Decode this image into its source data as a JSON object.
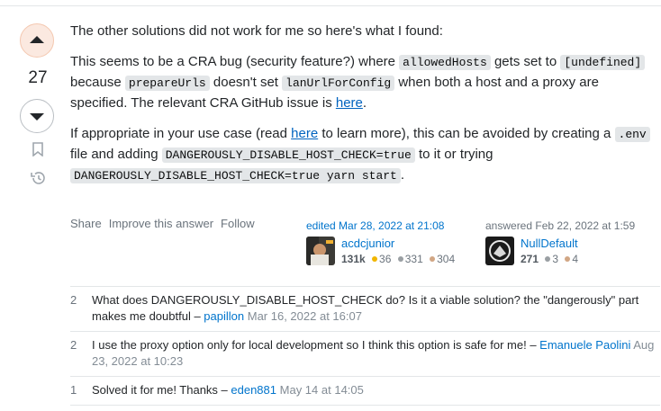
{
  "vote": {
    "count": "27"
  },
  "post": {
    "p1": "The other solutions did not work for me so here's what I found:",
    "p2_a": "This seems to be a CRA bug (security feature?) where ",
    "p2_code1": "allowedHosts",
    "p2_b": " gets set to ",
    "p2_code2": "[undefined]",
    "p2_c": " because ",
    "p2_code3": "prepareUrls",
    "p2_d": " doesn't set ",
    "p2_code4": "lanUrlForConfig",
    "p2_e": " when both a host and a proxy are specified. The relevant CRA GitHub issue is ",
    "p2_link": "here",
    "p2_f": ".",
    "p3_a": "If appropriate in your use case (read ",
    "p3_link": "here",
    "p3_b": " to learn more), this can be avoided by creating a ",
    "p3_code1": ".env",
    "p3_c": " file and adding ",
    "p3_code2": "DANGEROUSLY_DISABLE_HOST_CHECK=true",
    "p3_d": " to it or trying ",
    "p3_code3": "DANGEROUSLY_DISABLE_HOST_CHECK=true yarn start",
    "p3_e": "."
  },
  "menu": {
    "share": "Share",
    "improve": "Improve this answer",
    "follow": "Follow"
  },
  "editor": {
    "action": "edited Mar 28, 2022 at 21:08",
    "name": "acdcjunior",
    "rep": "131k",
    "gold": "36",
    "silver": "331",
    "bronze": "304"
  },
  "author": {
    "action": "answered Feb 22, 2022 at 1:59",
    "name": "NullDefault",
    "rep": "271",
    "silver": "3",
    "bronze": "4"
  },
  "comments": [
    {
      "score": "2",
      "text": "What does DANGEROUSLY_DISABLE_HOST_CHECK do? Is it a viable solution? the \"dangerously\" part makes me doubtful – ",
      "user": "papillon",
      "date": "Mar 16, 2022 at 16:07"
    },
    {
      "score": "2",
      "text": "I use the proxy option only for local development so I think this option is safe for me! – ",
      "user": "Emanuele Paolini",
      "date": "Aug 23, 2022 at 10:23"
    },
    {
      "score": "1",
      "text": "Solved it for me! Thanks – ",
      "user": "eden881",
      "date": "May 14 at 14:05"
    }
  ],
  "colors": {
    "link": "#0074cc",
    "gold": "#f1b600",
    "silver": "#9a9fa3",
    "bronze": "#d1a684",
    "upvote_bg": "#fbe9e0"
  }
}
